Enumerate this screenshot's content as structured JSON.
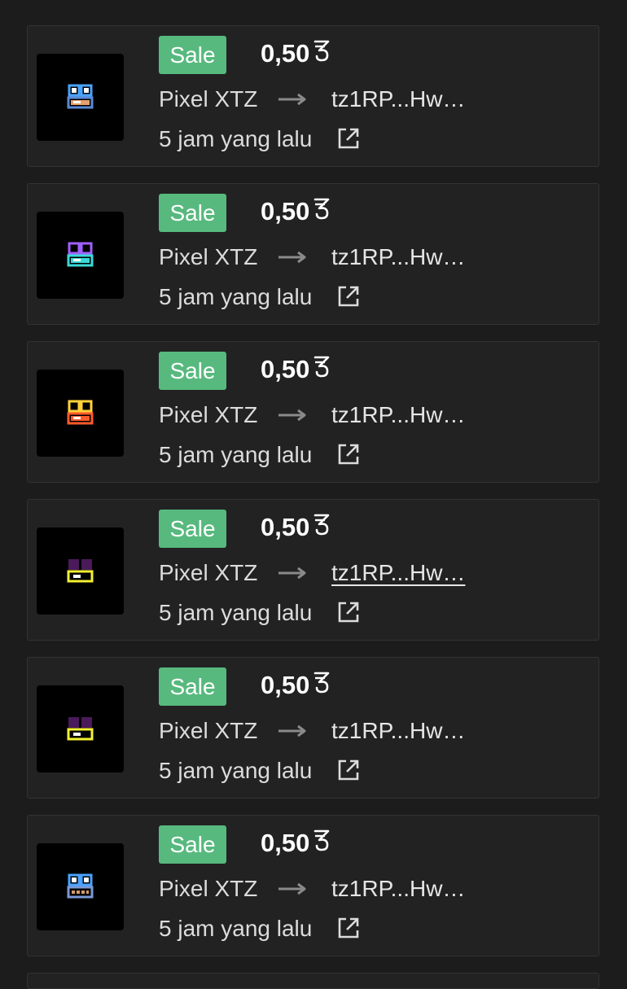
{
  "activity": [
    {
      "badge": "Sale",
      "price": "0,50",
      "from": "Pixel XTZ",
      "to": "tz1RP...Hw…",
      "time": "5 jam yang lalu",
      "to_underlined": false,
      "art": {
        "eyes": "#4aa3ff",
        "eye_inner": "#ffffff",
        "mouth": "#e8a06a",
        "mouth_border": "#5a8ad6",
        "style": "eyes-mouth"
      }
    },
    {
      "badge": "Sale",
      "price": "0,50",
      "from": "Pixel XTZ",
      "to": "tz1RP...Hw…",
      "time": "5 jam yang lalu",
      "to_underlined": false,
      "art": {
        "eyes": "#a060ff",
        "eye_inner": "#000000",
        "mouth": "#3ad9d9",
        "mouth_border": "#3ad9d9",
        "style": "eyes-mouth"
      }
    },
    {
      "badge": "Sale",
      "price": "0,50",
      "from": "Pixel XTZ",
      "to": "tz1RP...Hw…",
      "time": "5 jam yang lalu",
      "to_underlined": false,
      "art": {
        "eyes": "#ffd23a",
        "eye_inner": "#000000",
        "mouth": "#ff5a2a",
        "mouth_border": "#ff5a2a",
        "style": "eyes-mouth"
      }
    },
    {
      "badge": "Sale",
      "price": "0,50",
      "from": "Pixel XTZ",
      "to": "tz1RP...Hw…",
      "time": "5 jam yang lalu",
      "to_underlined": true,
      "art": {
        "eyes": "#4a1a5a",
        "eye_inner": "#4a1a5a",
        "mouth": "#f4f032",
        "mouth_border": "#f4f032",
        "style": "block-mouth"
      }
    },
    {
      "badge": "Sale",
      "price": "0,50",
      "from": "Pixel XTZ",
      "to": "tz1RP...Hw…",
      "time": "5 jam yang lalu",
      "to_underlined": false,
      "art": {
        "eyes": "#4a1a5a",
        "eye_inner": "#4a1a5a",
        "mouth": "#f4f032",
        "mouth_border": "#f4f032",
        "style": "block-mouth"
      }
    },
    {
      "badge": "Sale",
      "price": "0,50",
      "from": "Pixel XTZ",
      "to": "tz1RP...Hw…",
      "time": "5 jam yang lalu",
      "to_underlined": false,
      "art": {
        "eyes": "#4aa3ff",
        "eye_inner": "#ffffff",
        "mouth": "#d49a6a",
        "mouth_border": "#7a9ad6",
        "style": "teeth"
      }
    }
  ],
  "colors": {
    "badge_bg": "#57b97e",
    "card_bg": "#222222",
    "page_bg": "#1c1c1c"
  },
  "icons": {
    "currency": "tezos-icon",
    "transfer": "arrow-right-icon",
    "link": "external-link-icon"
  }
}
